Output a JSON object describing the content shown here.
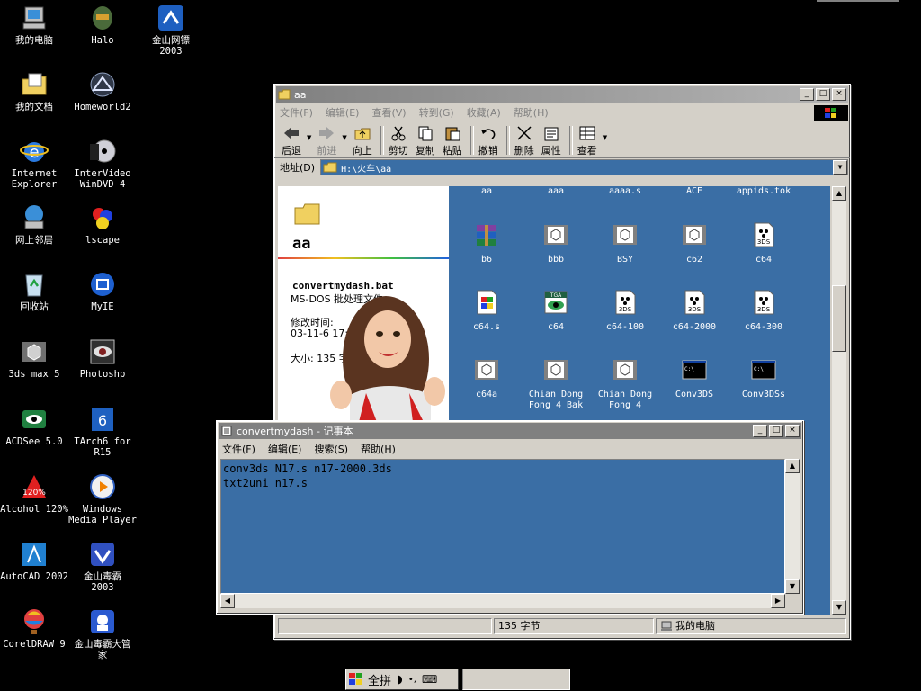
{
  "desktop_icons": [
    {
      "label": "我的电脑"
    },
    {
      "label": "Halo"
    },
    {
      "label": "金山网镖\n2003"
    },
    {
      "label": "我的文档"
    },
    {
      "label": "Homeworld2"
    },
    {
      "label": "Internet\nExplorer"
    },
    {
      "label": "InterVideo\nWinDVD 4"
    },
    {
      "label": "网上邻居"
    },
    {
      "label": "lscape"
    },
    {
      "label": "回收站"
    },
    {
      "label": "MyIE"
    },
    {
      "label": "3ds max 5"
    },
    {
      "label": "Photoshp"
    },
    {
      "label": "ACDSee 5.0"
    },
    {
      "label": "TArch6 for\nR15"
    },
    {
      "label": "Alcohol 120%"
    },
    {
      "label": "Windows\nMedia Player"
    },
    {
      "label": "AutoCAD 2002"
    },
    {
      "label": "金山毒霸\n2003"
    },
    {
      "label": "CorelDRAW 9"
    },
    {
      "label": "金山毒霸大管\n家"
    }
  ],
  "explorer": {
    "title": "aa",
    "menu": [
      "文件(F)",
      "编辑(E)",
      "查看(V)",
      "转到(G)",
      "收藏(A)",
      "帮助(H)"
    ],
    "toolbar": {
      "back": "后退",
      "forward": "前进",
      "up": "向上",
      "cut": "剪切",
      "copy": "复制",
      "paste": "粘贴",
      "undo": "撤销",
      "delete": "删除",
      "properties": "属性",
      "views": "查看"
    },
    "address_label": "地址(D)",
    "address_value": "H:\\火车\\aa",
    "folder_name": "aa",
    "selected_file": "convertmydash.bat",
    "file_type": "MS-DOS 批处理文件",
    "modified_label": "修改时间:",
    "modified_value": "03-11-6 17:43",
    "size_label": "大小: 135 字节",
    "row0": [
      "aa",
      "aaa",
      "aaaa.s",
      "ACE",
      "appids.tok"
    ],
    "files": [
      {
        "name": "b6",
        "icon": "winrar-icon"
      },
      {
        "name": "bbb",
        "icon": "3ds-max-file-icon"
      },
      {
        "name": "BSY",
        "icon": "3ds-max-file-icon"
      },
      {
        "name": "c62",
        "icon": "3ds-max-file-icon"
      },
      {
        "name": "c64",
        "icon": "3ds-document-icon"
      },
      {
        "name": "c64.s",
        "icon": "windows-file-icon"
      },
      {
        "name": "c64",
        "icon": "tga-image-icon"
      },
      {
        "name": "c64-100",
        "icon": "3ds-document-icon"
      },
      {
        "name": "c64-2000",
        "icon": "3ds-document-icon"
      },
      {
        "name": "c64-300",
        "icon": "3ds-document-icon"
      },
      {
        "name": "c64a",
        "icon": "3ds-max-file-icon"
      },
      {
        "name": "Chian Dong\nFong 4 Bak",
        "icon": "3ds-max-file-icon"
      },
      {
        "name": "Chian Dong\nFong 4",
        "icon": "3ds-max-file-icon"
      },
      {
        "name": "Conv3DS",
        "icon": "console-icon"
      },
      {
        "name": "Conv3DSs",
        "icon": "console-icon"
      }
    ],
    "status_size": "135 字节",
    "status_zone": "我的电脑"
  },
  "notepad": {
    "title": "convertmydash - 记事本",
    "menu": [
      "文件(F)",
      "编辑(E)",
      "搜索(S)",
      "帮助(H)"
    ],
    "content": "conv3ds N17.s n17-2000.3ds\ntxt2uni n17.s"
  },
  "ime_bar": {
    "label": "全拼"
  },
  "colors": {
    "desktop": "#000000",
    "folder_bg": "#3a6ea5",
    "window_face": "#d4d0c8"
  }
}
